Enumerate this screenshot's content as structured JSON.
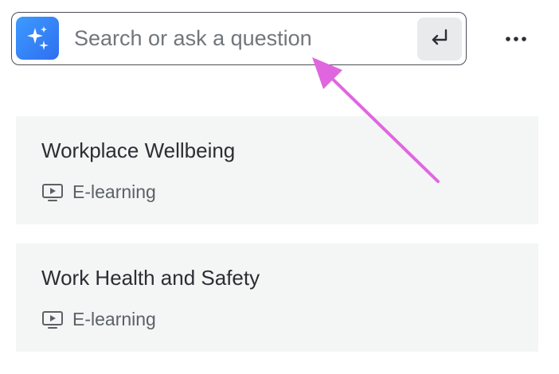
{
  "search": {
    "placeholder": "Search or ask a question",
    "value": "",
    "ai_icon": "sparkles-icon",
    "submit_icon": "enter-return-icon"
  },
  "menu": {
    "icon": "more-horizontal-icon"
  },
  "results": [
    {
      "title": "Workplace Wellbeing",
      "type_label": "E-learning",
      "type_icon": "monitor-play-icon"
    },
    {
      "title": "Work Health and Safety",
      "type_label": "E-learning",
      "type_icon": "monitor-play-icon"
    }
  ],
  "colors": {
    "accent_gradient_start": "#3d9bff",
    "accent_gradient_end": "#2f6ef0",
    "card_background": "#f4f5f5",
    "annotation_arrow": "#e066e0"
  }
}
